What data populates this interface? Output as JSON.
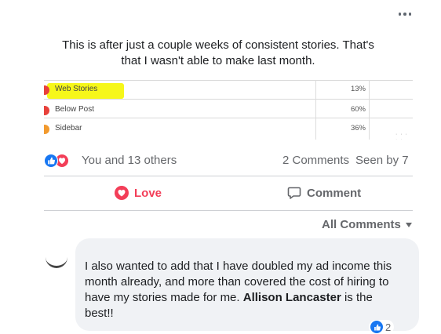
{
  "post": {
    "text_line1": "This is after just a couple weeks of consistent stories. That's",
    "text_line2": "that I wasn't able to make last month."
  },
  "embedded_table": {
    "rows": [
      {
        "label": "Web Stories",
        "percent": "13%",
        "marker_color": "#e8413b"
      },
      {
        "label": "Below Post",
        "percent": "60%",
        "marker_color": "#e8413b"
      },
      {
        "label": "Sidebar",
        "percent": "36%",
        "marker_color": "#f29a2e"
      }
    ],
    "highlight_color": "#f6f71a"
  },
  "reactions": {
    "summary": "You and 13 others",
    "comments_count": "2 Comments",
    "seen_by": "Seen by 7"
  },
  "actions": {
    "love_label": "Love",
    "comment_label": "Comment"
  },
  "comments": {
    "filter_label": "All Comments",
    "comment": {
      "text_part1": "I also wanted to add that I have doubled my ad income this month already, and more than covered the cost of hiring to have my stories made for me. ",
      "mention": "Allison Lancaster",
      "text_part2": " is the best!!",
      "reaction_count": "2"
    }
  },
  "colors": {
    "like_blue": "#1877f2",
    "love_red": "#f33e58",
    "secondary_text": "#65676b"
  }
}
